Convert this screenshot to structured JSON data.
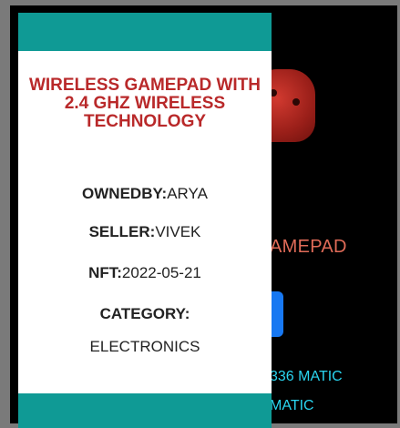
{
  "back_card": {
    "title_fragment": "AMEPAD",
    "price_line_1": "336 MATIC",
    "price_line_2": "MATIC"
  },
  "front_card": {
    "title": "WIRELESS GAMEPAD WITH 2.4 GHZ WIRELESS TECHNOLOGY",
    "owned_by_label": "OWNEDBY:",
    "owned_by_value": "ARYA",
    "seller_label": "SELLER:",
    "seller_value": "VIVEK",
    "nft_label": "NFT:",
    "nft_value": "2022-05-21",
    "category_label": "CATEGORY:",
    "category_value": "ELECTRONICS"
  },
  "colors": {
    "teal_band": "#0f9a95",
    "title_red": "#b9292a",
    "price_cyan": "#2ad5f0",
    "button_blue": "#1778f2"
  },
  "icons": [
    "gamepad-image"
  ]
}
